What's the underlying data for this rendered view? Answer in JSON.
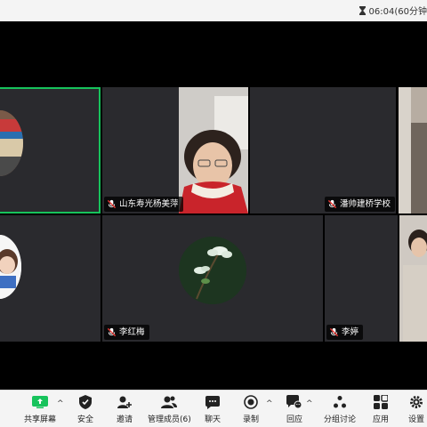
{
  "topbar": {
    "timer_text": "06:04(60分钟"
  },
  "participants": [
    {
      "name": ""
    },
    {
      "name": "山东寿光杨美萍"
    },
    {
      "name": "潘帅建桥学校"
    },
    {
      "name": ""
    },
    {
      "name": "李红梅"
    },
    {
      "name": "李婷"
    }
  ],
  "toolbar": {
    "share": "共享屏幕",
    "security": "安全",
    "invite": "邀请",
    "members": "管理成员(6)",
    "chat": "聊天",
    "record": "录制",
    "reactions": "回应",
    "breakout": "分组讨论",
    "apps": "应用",
    "settings": "设置"
  },
  "colors": {
    "active_speaker": "#17c35c",
    "tile_bg": "#2a2a2e",
    "share_green": "#17c35c"
  }
}
